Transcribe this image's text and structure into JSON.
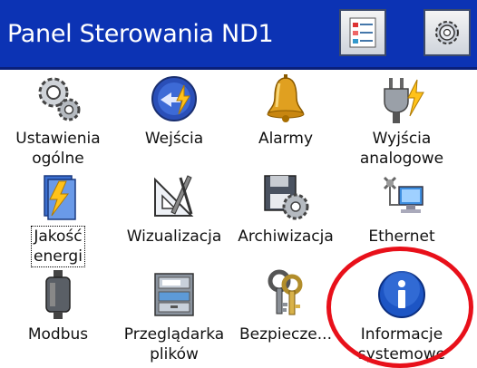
{
  "window": {
    "title": "Panel Sterowania ND1",
    "buttons": [
      "view-toggle-icon",
      "settings-gear-icon"
    ]
  },
  "items": [
    {
      "icon": "gears-icon",
      "label1": "Ustawienia",
      "label2": "ogólne"
    },
    {
      "icon": "input-lightning-icon",
      "label1": "Wejścia",
      "label2": ""
    },
    {
      "icon": "bell-icon",
      "label1": "Alarmy",
      "label2": ""
    },
    {
      "icon": "plug-lightning-icon",
      "label1": "Wyjścia",
      "label2": "analogowe"
    },
    {
      "icon": "energy-document-icon",
      "label1": "Jakość",
      "label2": "energi"
    },
    {
      "icon": "drawing-tools-icon",
      "label1": "Wizualizacja",
      "label2": ""
    },
    {
      "icon": "floppy-gear-icon",
      "label1": "Archiwizacja",
      "label2": ""
    },
    {
      "icon": "network-computer-icon",
      "label1": "Ethernet",
      "label2": ""
    },
    {
      "icon": "module-icon",
      "label1": "Modbus",
      "label2": ""
    },
    {
      "icon": "file-cabinet-icon",
      "label1": "Przeglądarka",
      "label2": "plików"
    },
    {
      "icon": "keys-icon",
      "label1": "Bezpiecze...",
      "label2": ""
    },
    {
      "icon": "info-icon",
      "label1": "Informacje",
      "label2": "systemowe"
    }
  ],
  "colors": {
    "titlebar": "#0c33b4",
    "highlight": "#e8101a"
  }
}
